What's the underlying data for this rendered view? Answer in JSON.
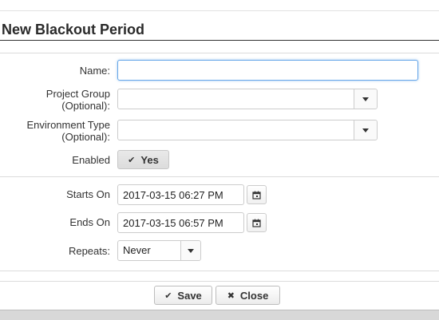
{
  "dialog": {
    "title": "New Blackout Period"
  },
  "form": {
    "name": {
      "label": "Name:",
      "value": ""
    },
    "project_group": {
      "label_line1": "Project Group",
      "label_line2": "(Optional):",
      "value": ""
    },
    "environment_type": {
      "label_line1": "Environment Type",
      "label_line2": "(Optional):",
      "value": ""
    },
    "enabled": {
      "label": "Enabled",
      "toggle_label": "Yes",
      "toggle_state": true
    },
    "starts_on": {
      "label": "Starts On",
      "value": "2017-03-15 06:27 PM"
    },
    "ends_on": {
      "label": "Ends On",
      "value": "2017-03-15 06:57 PM"
    },
    "repeats": {
      "label": "Repeats:",
      "value": "Never"
    }
  },
  "buttons": {
    "save_label": "Save",
    "close_label": "Close"
  },
  "icons": {
    "check": "check-icon",
    "close": "x-icon",
    "calendar": "calendar-icon",
    "caret": "chevron-down-icon"
  },
  "colors": {
    "focus_border": "#66a6e8",
    "title_rule": "#333333"
  }
}
